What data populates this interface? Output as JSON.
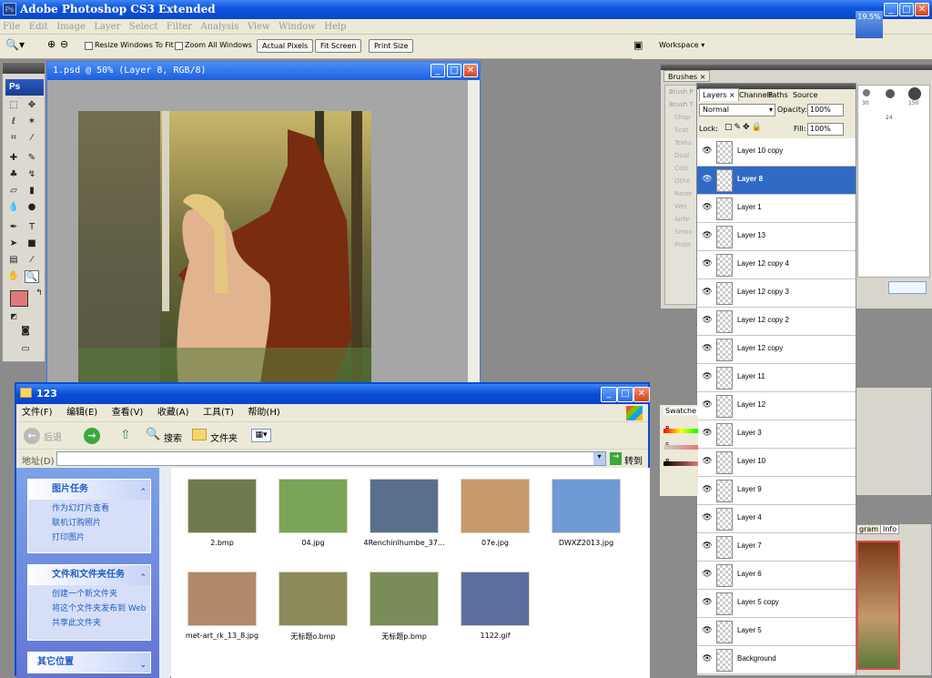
{
  "app": {
    "title": "Adobe Photoshop CS3 Extended",
    "logo": "Ps",
    "window_buttons": [
      "_",
      "□",
      "✕"
    ]
  },
  "menu": [
    "File",
    "Edit",
    "Image",
    "Layer",
    "Select",
    "Filter",
    "Analysis",
    "View",
    "Window",
    "Help"
  ],
  "options": {
    "resize_label": "Resize Windows To Fit",
    "zoom_all_label": "Zoom All Windows",
    "actual_pixels": "Actual Pixels",
    "fit_screen": "Fit Screen",
    "print_size": "Print Size",
    "workspace": "Workspace ▾",
    "zoom_readout": "19.5%"
  },
  "toolbox": {
    "logo": "Ps",
    "foreground_color": "#e07a7a",
    "background_color": "#ffffff"
  },
  "document": {
    "title": "1.psd @ 50% (Layer 8, RGB/8)"
  },
  "brushes": {
    "tab": "Brushes",
    "items": [
      "Brush P",
      "Brush T",
      "Shap",
      "Scat",
      "Textu",
      "Dual",
      "Colo",
      "Othe",
      "Noise",
      "Wet",
      "Airbr",
      "Smoo",
      "Prote"
    ],
    "sizes": [
      "30",
      "150",
      "24"
    ]
  },
  "layers": {
    "tabs": [
      "Layers",
      "Channels",
      "Paths",
      "Source"
    ],
    "blend_mode": "Normal",
    "opacity_label": "Opacity:",
    "opacity": "100%",
    "lock_label": "Lock:",
    "fill_label": "Fill:",
    "fill": "100%",
    "list": [
      {
        "name": "Layer 10 copy",
        "selected": false
      },
      {
        "name": "Layer 8",
        "selected": true
      },
      {
        "name": "Layer 1",
        "selected": false
      },
      {
        "name": "Layer 13",
        "selected": false
      },
      {
        "name": "Layer 12 copy 4",
        "selected": false
      },
      {
        "name": "Layer 12 copy 3",
        "selected": false
      },
      {
        "name": "Layer 12 copy 2",
        "selected": false
      },
      {
        "name": "Layer 12 copy",
        "selected": false
      },
      {
        "name": "Layer 11",
        "selected": false
      },
      {
        "name": "Layer 12",
        "selected": false
      },
      {
        "name": "Layer 3",
        "selected": false
      },
      {
        "name": "Layer 10",
        "selected": false
      },
      {
        "name": "Layer 9",
        "selected": false
      },
      {
        "name": "Layer 4",
        "selected": false
      },
      {
        "name": "Layer 7",
        "selected": false
      },
      {
        "name": "Layer 6",
        "selected": false
      },
      {
        "name": "Layer 5 copy",
        "selected": false
      },
      {
        "name": "Layer 5",
        "selected": false
      },
      {
        "name": "Background",
        "selected": false
      }
    ]
  },
  "swatches": {
    "tab": "Swatche",
    "rows": [
      "R",
      "S",
      "B"
    ]
  },
  "navigator": {
    "tabs": [
      "gram",
      "Info"
    ]
  },
  "explorer": {
    "title": "123",
    "menu": [
      "文件(F)",
      "编辑(E)",
      "查看(V)",
      "收藏(A)",
      "工具(T)",
      "帮助(H)"
    ],
    "back": "后退",
    "search": "搜索",
    "folders": "文件夹",
    "address_label": "地址(D)",
    "go": "转到",
    "picture_tasks": {
      "title": "图片任务",
      "items": [
        "作为幻灯片查看",
        "联机订购照片",
        "打印图片"
      ]
    },
    "file_tasks": {
      "title": "文件和文件夹任务",
      "items": [
        "创建一个新文件夹",
        "将这个文件夹发布到 Web",
        "共享此文件夹"
      ]
    },
    "other_places": {
      "title": "其它位置"
    },
    "files": [
      {
        "name": "2.bmp",
        "color": "#6f7a4e"
      },
      {
        "name": "04.jpg",
        "color": "#7aa456"
      },
      {
        "name": "4Renchinlhumbe_37...",
        "color": "#5a6f8c"
      },
      {
        "name": "07e.jpg",
        "color": "#c69a6a"
      },
      {
        "name": "DWXZ2013.jpg",
        "color": "#6f9ad6"
      },
      {
        "name": "met-art_rk_13_8.jpg",
        "color": "#b08a6a"
      },
      {
        "name": "无标题o.bmp",
        "color": "#8c8a5a"
      },
      {
        "name": "无标题p.bmp",
        "color": "#7a8c5a"
      },
      {
        "name": "1122.gif",
        "color": "#5a6fa0"
      }
    ]
  }
}
